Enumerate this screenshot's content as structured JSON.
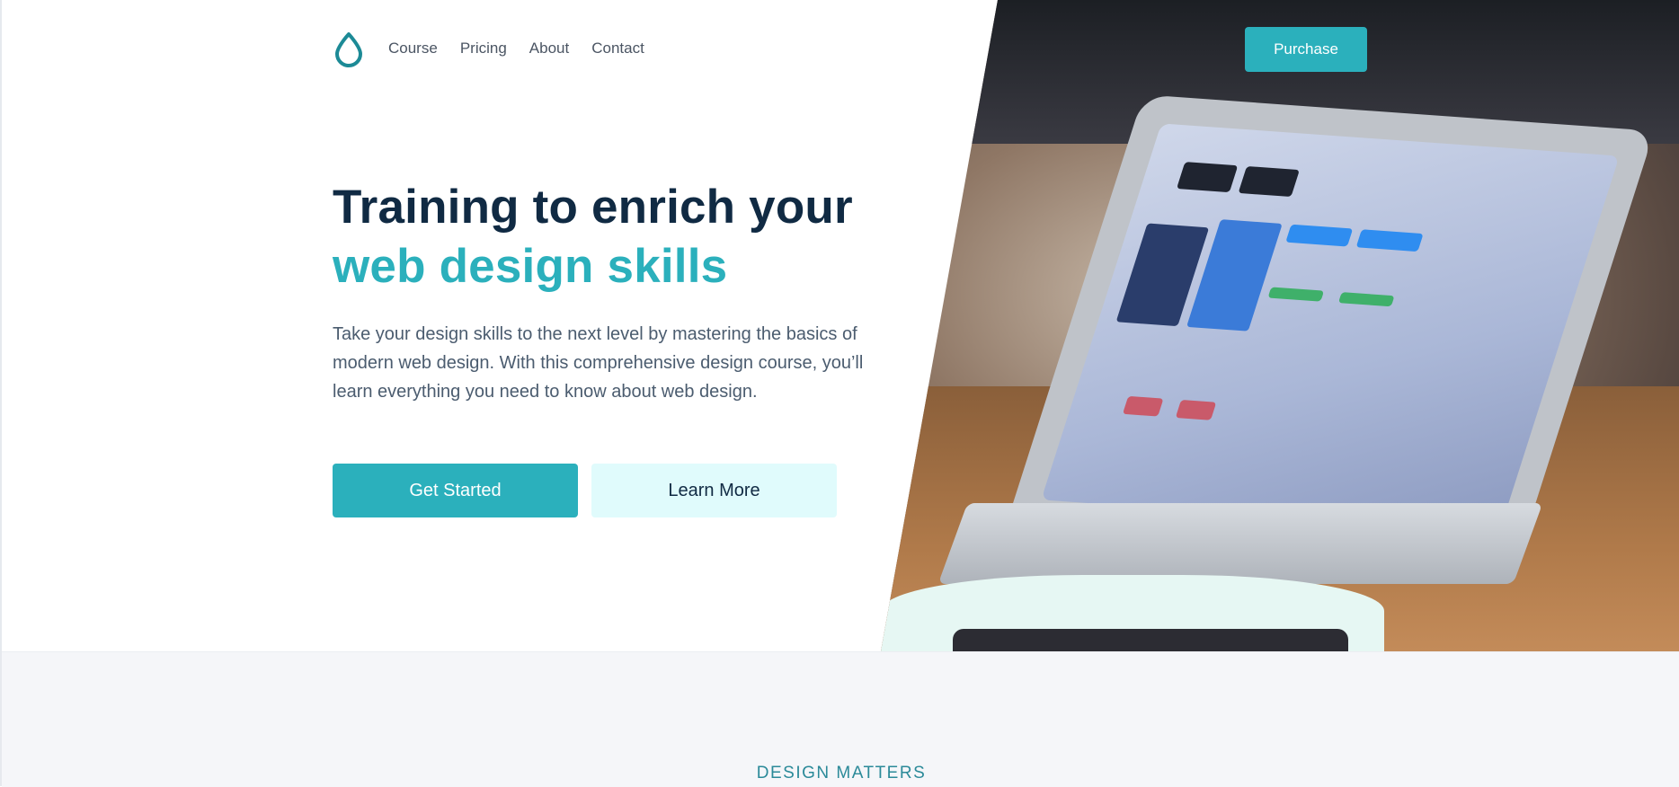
{
  "nav": {
    "logo": "droplet-icon",
    "links": [
      "Course",
      "Pricing",
      "About",
      "Contact"
    ],
    "purchase_label": "Purchase"
  },
  "hero": {
    "title_line1": "Training to enrich your",
    "title_line2": "web design skills",
    "description": "Take your design skills to the next level by mastering the basics of modern web design. With this comprehensive design course, you’ll learn everything you need to know about web design.",
    "primary_button": "Get Started",
    "secondary_button": "Learn More",
    "image": "laptop-photo"
  },
  "section": {
    "eyebrow": "DESIGN MATTERS"
  },
  "colors": {
    "accent": "#2bb0bc",
    "heading": "#102a43",
    "body_text": "#4b5c6f",
    "secondary_button_bg": "#e0fbfc",
    "section_bg": "#f5f6f9"
  }
}
